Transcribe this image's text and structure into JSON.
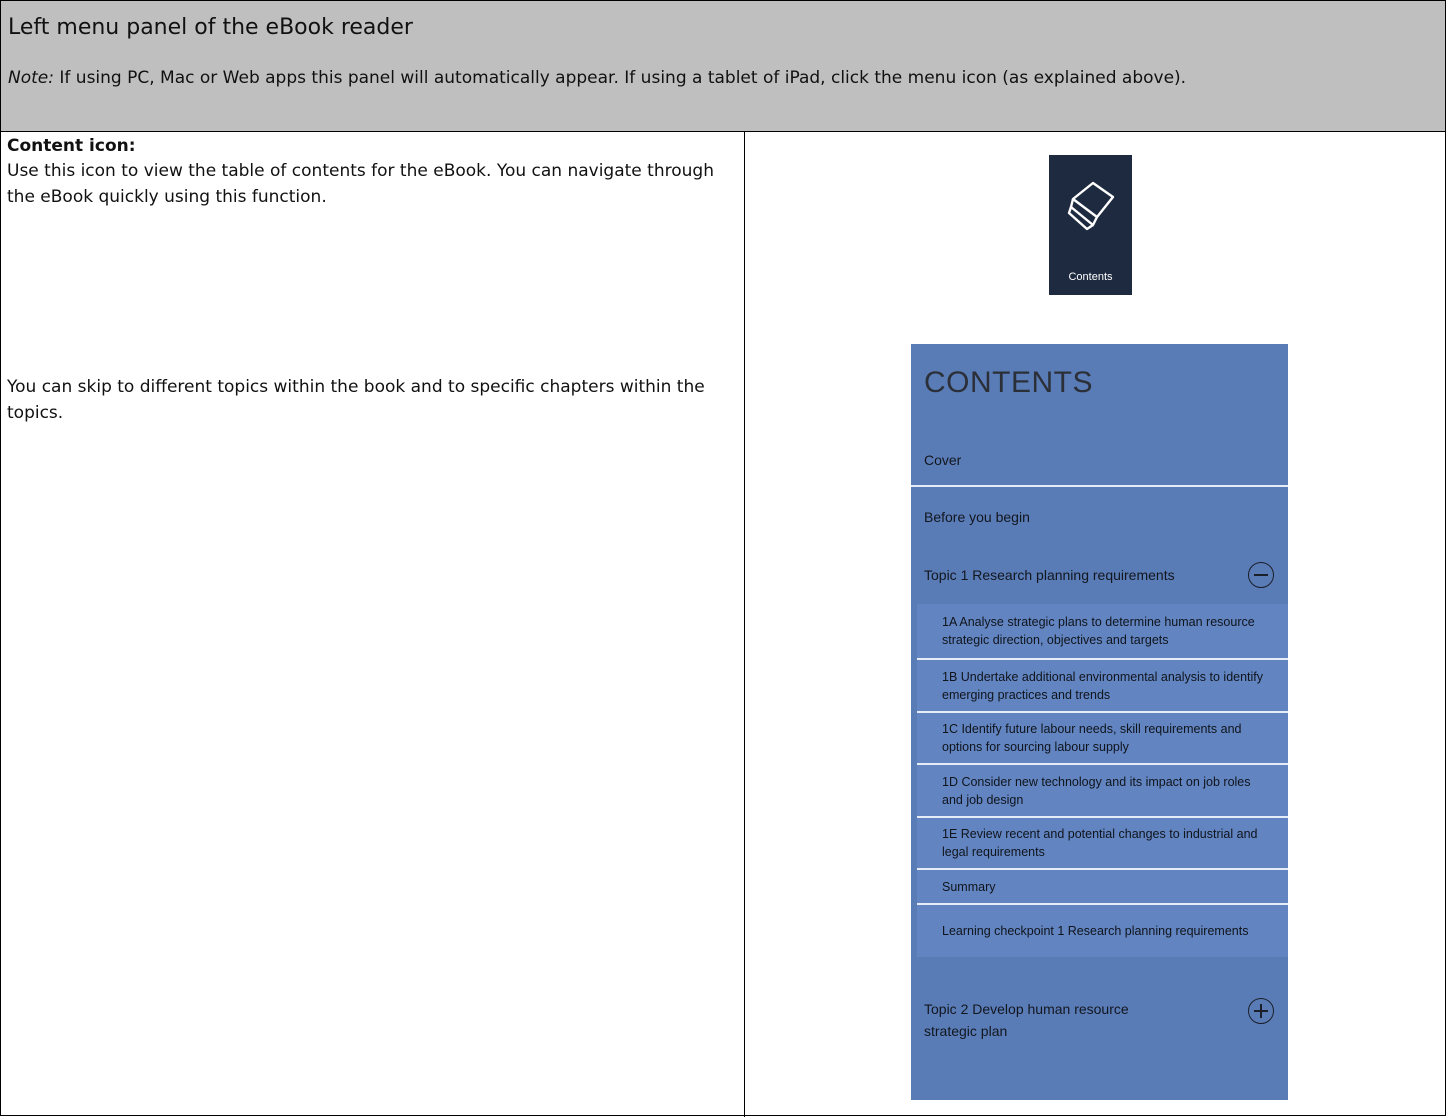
{
  "header": {
    "title": "Left menu panel of the eBook reader",
    "note_label": "Note:",
    "note_text": " If using PC, Mac or Web apps this panel will automatically appear. If using a tablet of iPad, click the menu icon (as explained above)."
  },
  "left": {
    "label": "Content icon:",
    "para1": "Use this icon to view the table of contents for the eBook. You can navigate through the eBook quickly using this function.",
    "para2": "You can skip to different topics within the book and to specific chapters within the topics."
  },
  "icon_tile": {
    "icon": "open-book-icon",
    "label": "Contents"
  },
  "panel": {
    "title": "CONTENTS",
    "items": [
      "Cover",
      "Before you begin",
      "Topic 1 Research planning requirements"
    ],
    "subitems": [
      "1A Analyse strategic plans to determine human resource strategic direction, objectives and targets",
      "1B Undertake additional environmental analysis to identify emerging practices and trends",
      "1C Identify future labour needs, skill requirements and options for sourcing labour supply",
      "1D Consider new technology and its impact on job roles and job design",
      "1E Review recent and potential changes to industrial and legal requirements",
      "Summary",
      "Learning checkpoint 1 Research planning requirements"
    ],
    "topic2": "Topic 2 Develop human resource strategic plan",
    "colors": {
      "panel": "#5a7cb6",
      "sub": "#6285c1",
      "tile": "#1e2a40",
      "header": "#bfbfbf"
    }
  }
}
